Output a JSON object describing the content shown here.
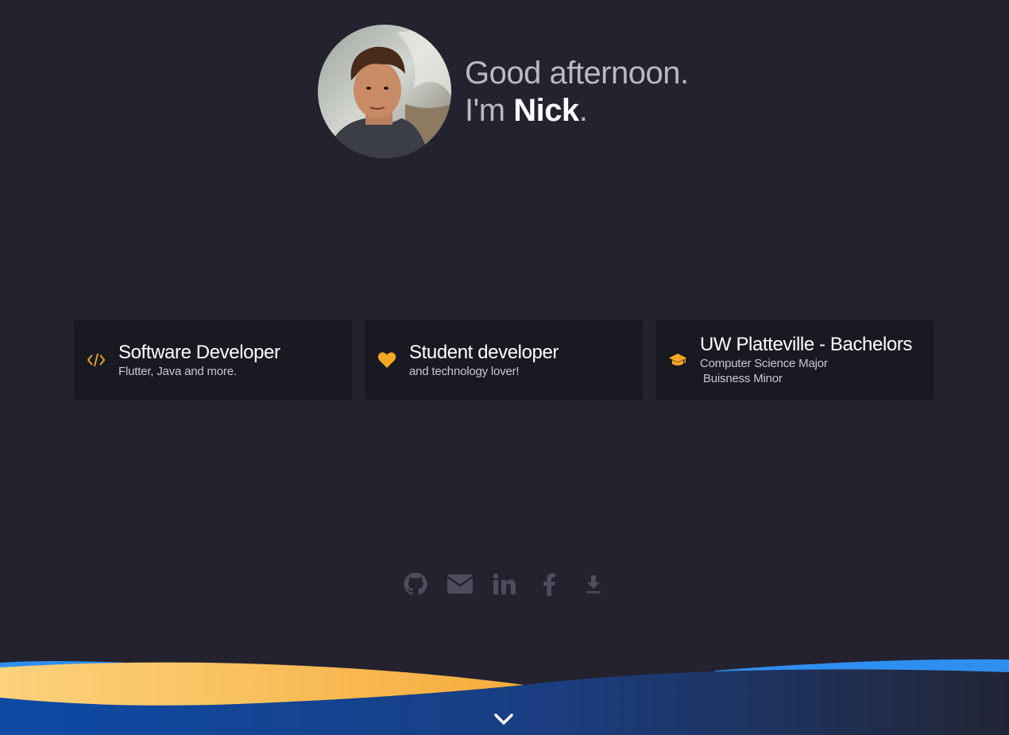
{
  "hero": {
    "greeting_line": "Good afternoon.",
    "im_prefix": "I'm ",
    "name": "Nick",
    "name_suffix": "."
  },
  "cards": [
    {
      "icon": "code-icon",
      "title": "Software Developer",
      "subtitle": "Flutter, Java and more."
    },
    {
      "icon": "heart-icon",
      "title": "Student developer",
      "subtitle": "and technology lover!"
    },
    {
      "icon": "graduation-cap-icon",
      "title": "UW Platteville - Bachelors",
      "subtitle_line1": "Computer Science Major",
      "subtitle_line2": " Buisness Minor"
    }
  ],
  "social": [
    "github-icon",
    "email-icon",
    "linkedin-icon",
    "facebook-icon",
    "download-icon"
  ],
  "colors": {
    "background": "#23222e",
    "card_background": "#191921",
    "accent": "#f5a623",
    "social_icon": "#4e4d5c",
    "wave_yellow": "#f8b84e",
    "wave_blue": "#1c4fa4",
    "wave_light_blue": "#2f8ff0"
  }
}
